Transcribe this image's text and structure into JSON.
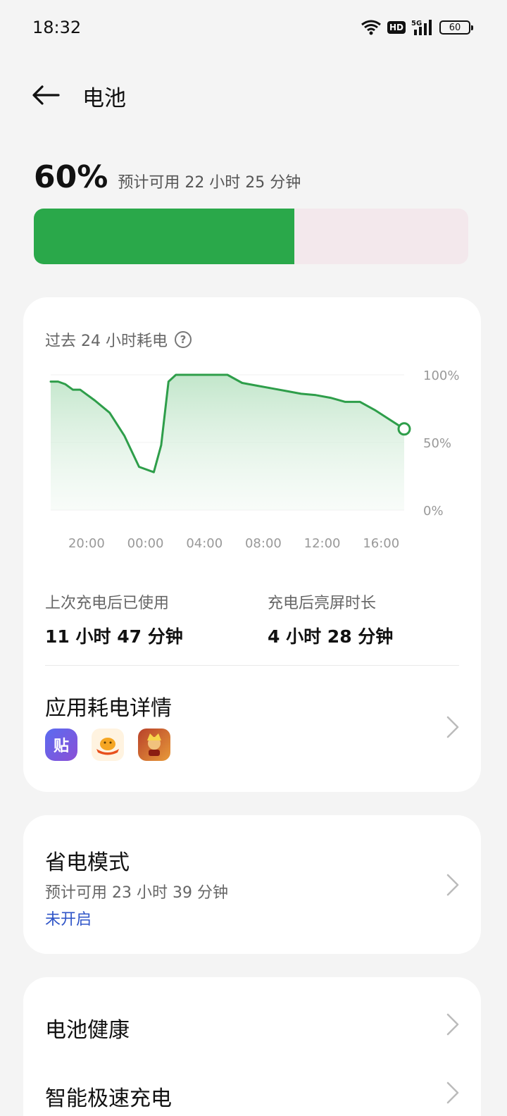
{
  "status_bar": {
    "time": "18:32",
    "hd": "HD",
    "network": "5G",
    "battery": "60"
  },
  "header": {
    "title": "电池"
  },
  "battery_level": {
    "percent_text": "60%",
    "estimate": "预计可用 22 小时 25 分钟",
    "fill_fraction": 0.6,
    "fill_color": "#2aa84a",
    "empty_color": "#f3e8ec"
  },
  "usage_card": {
    "title": "过去 24 小时耗电",
    "stats": {
      "since_charge_label": "上次充电后已使用",
      "since_charge_value": "11 小时 47 分钟",
      "screen_on_label": "充电后亮屏时长",
      "screen_on_value": "4 小时 28 分钟"
    },
    "apps": {
      "title": "应用耗电详情",
      "icons": [
        "tieba-app-icon",
        "food-delivery-app-icon",
        "game-app-icon"
      ],
      "tieba_glyph": "贴"
    }
  },
  "chart_data": {
    "type": "area",
    "title": "",
    "xlabel": "",
    "ylabel": "",
    "x_ticks": [
      "20:00",
      "00:00",
      "04:00",
      "08:00",
      "12:00",
      "16:00"
    ],
    "y_ticks": [
      "100%",
      "50%",
      "0%"
    ],
    "ylim": [
      0,
      100
    ],
    "xlim_hours": [
      -1,
      23
    ],
    "series": [
      {
        "x_hours": [
          -1,
          -0.5,
          0,
          0.5,
          1,
          1.5,
          2,
          3,
          4,
          5,
          6,
          6.5,
          7,
          7.5,
          8,
          8.5,
          9,
          10,
          11,
          12,
          13,
          14,
          15,
          16,
          17,
          18,
          19,
          20,
          21,
          22,
          23
        ],
        "values": [
          95,
          95,
          93,
          89,
          89,
          85,
          81,
          72,
          55,
          32,
          28,
          48,
          95,
          100,
          100,
          100,
          100,
          100,
          100,
          94,
          92,
          90,
          88,
          86,
          85,
          83,
          80,
          80,
          74,
          67,
          60
        ]
      }
    ],
    "line_color": "#2e9e4a",
    "grid": true
  },
  "power_saver": {
    "title": "省电模式",
    "estimate": "预计可用 23 小时 39 分钟",
    "status": "未开启",
    "status_color": "#2f55c8"
  },
  "more": {
    "battery_health": "电池健康",
    "fast_charge": "智能极速充电"
  }
}
